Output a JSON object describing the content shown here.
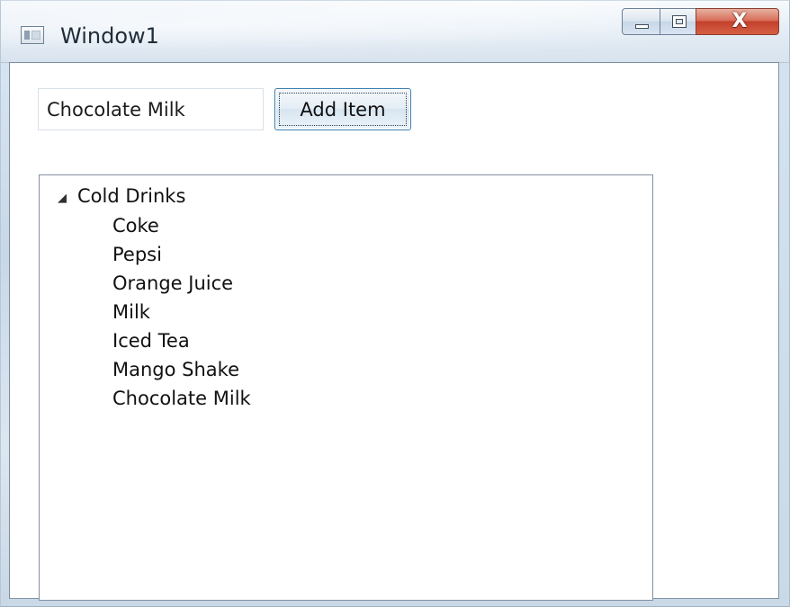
{
  "window": {
    "title": "Window1",
    "close_symbol": "X"
  },
  "form": {
    "textbox_value": "Chocolate Milk",
    "add_button_label": "Add Item"
  },
  "tree": {
    "root_label": "Cold Drinks",
    "expander_glyph": "◢",
    "items": [
      "Coke",
      "Pepsi",
      "Orange Juice",
      "Milk",
      "Iced Tea",
      "Mango Shake",
      "Chocolate Milk"
    ]
  }
}
